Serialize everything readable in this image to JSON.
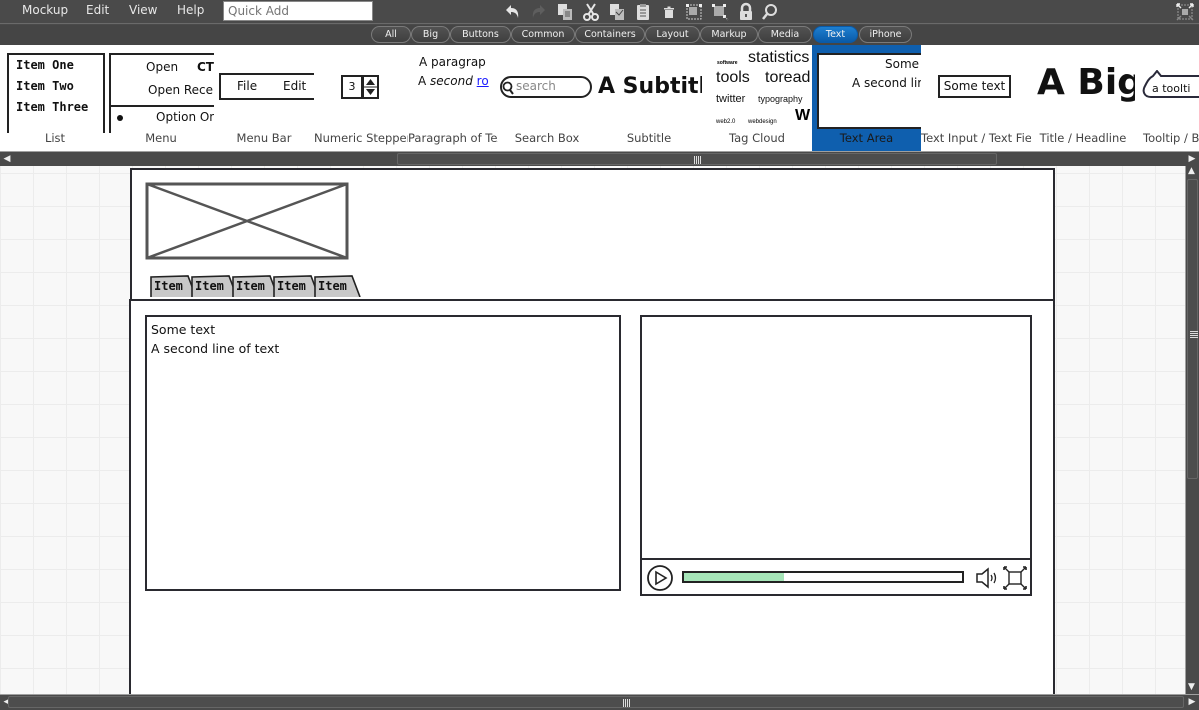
{
  "menubar": {
    "items": [
      "Mockup",
      "Edit",
      "View",
      "Help"
    ],
    "quick_add_placeholder": "Quick Add",
    "tools": [
      "undo-icon",
      "redo-icon",
      "copy-icon",
      "cut-icon",
      "duplicate-icon",
      "paste-icon",
      "delete-icon",
      "group-icon",
      "ungroup-icon",
      "lock-icon",
      "search-icon"
    ],
    "fullscreen_icon": "fullscreen-icon"
  },
  "filters": {
    "items": [
      "All",
      "Big",
      "Buttons",
      "Common",
      "Containers",
      "Layout",
      "Markup",
      "Media",
      "Text",
      "iPhone"
    ],
    "active": "Text"
  },
  "library": {
    "items": [
      {
        "label": "List",
        "preview": [
          "Item One",
          "Item Two",
          "Item Three"
        ]
      },
      {
        "label": "Menu",
        "preview": [
          "Open",
          "CT",
          "Open Recen",
          "Option On"
        ]
      },
      {
        "label": "Menu Bar",
        "preview": [
          "File",
          "Edit"
        ]
      },
      {
        "label": "Numeric Stepper",
        "preview": [
          "3"
        ]
      },
      {
        "label": "Paragraph of Text",
        "preview": [
          "A paragrap",
          "A",
          "second",
          "ro"
        ]
      },
      {
        "label": "Search Box",
        "preview": [
          "search"
        ]
      },
      {
        "label": "Subtitle",
        "preview": [
          "A Subtitle"
        ]
      },
      {
        "label": "Tag Cloud",
        "preview": [
          "software",
          "statistics",
          "tools",
          "toread",
          "twitter",
          "typography",
          "web2.0",
          "webdesign",
          "W"
        ]
      },
      {
        "label": "Text Area",
        "preview": [
          "Some",
          "A second lir"
        ],
        "selected": true
      },
      {
        "label": "Text Input / Text Field",
        "preview": [
          "Some text"
        ]
      },
      {
        "label": "Title / Headline",
        "preview": [
          "A Big"
        ]
      },
      {
        "label": "Tooltip / Ba",
        "preview": [
          "a toolti"
        ]
      }
    ]
  },
  "mockup": {
    "tabs": [
      "Item",
      "Item",
      "Item",
      "Item",
      "Item"
    ],
    "textarea": {
      "line1": "Some text",
      "line2": "A second line of text"
    },
    "video": {
      "progress_percent": 36
    }
  }
}
